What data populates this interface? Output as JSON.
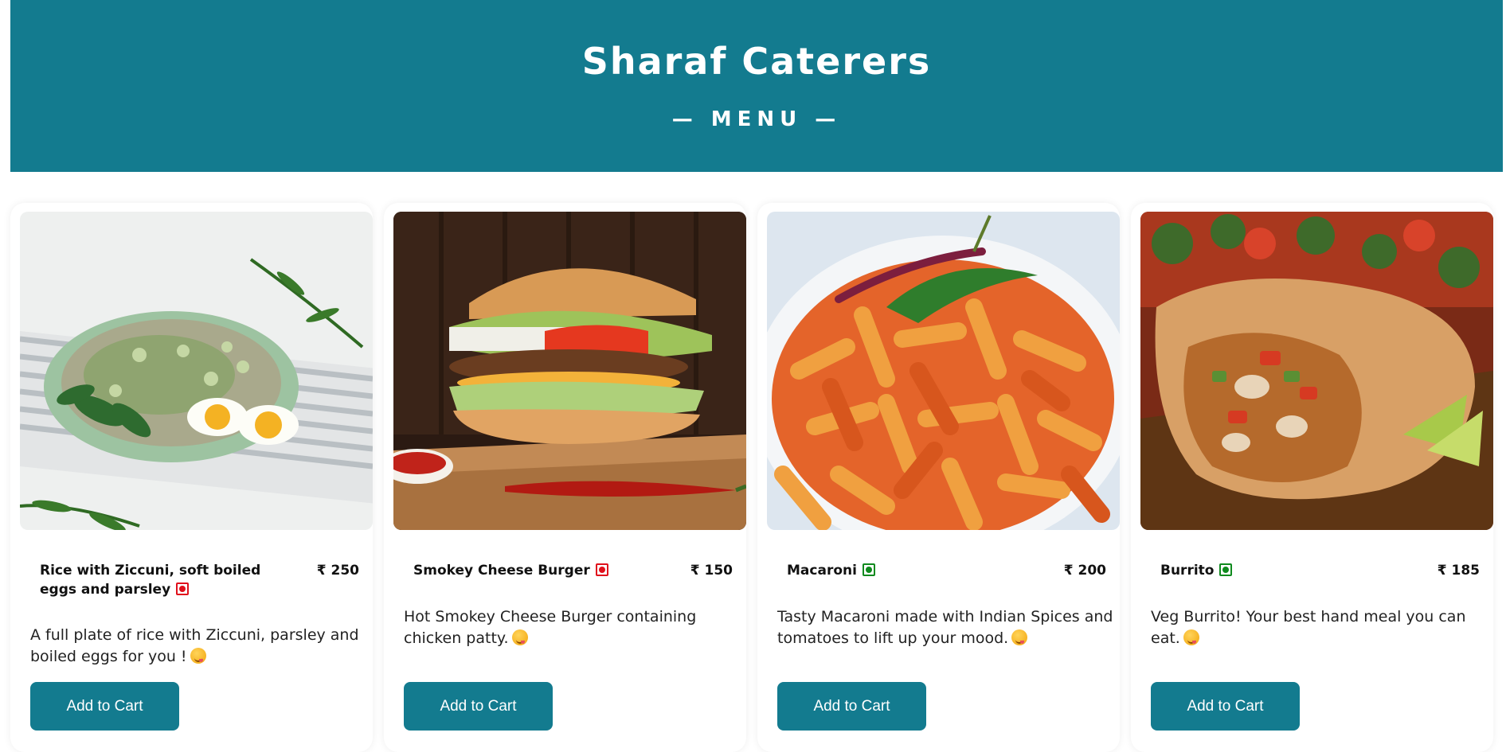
{
  "header": {
    "title": "Sharaf Caterers",
    "subtitle": "— MENU —",
    "background_color": "#137b8f"
  },
  "currency_symbol": "₹",
  "items": [
    {
      "name": "Rice with Ziccuni, soft boiled eggs and parsley",
      "diet": "non-veg",
      "price": "₹ 250",
      "description": "A full plate of rice with Ziccuni, parsley and boiled eggs for you !",
      "button_label": "Add to Cart",
      "photo_icon": "rice-bowl-photo"
    },
    {
      "name": "Smokey Cheese Burger",
      "diet": "non-veg",
      "price": "₹ 150",
      "description": "Hot Smokey Cheese Burger containing chicken patty.",
      "button_label": "Add to Cart",
      "photo_icon": "burger-photo"
    },
    {
      "name": "Macaroni",
      "diet": "veg",
      "price": "₹ 200",
      "description": "Tasty Macaroni made with Indian Spices and tomatoes to lift up your mood.",
      "button_label": "Add to Cart",
      "photo_icon": "pasta-photo"
    },
    {
      "name": "Burrito",
      "diet": "veg",
      "price": "₹ 185",
      "description": "Veg Burrito! Your best hand meal you can eat.",
      "button_label": "Add to Cart",
      "photo_icon": "burrito-photo"
    }
  ],
  "colors": {
    "accent": "#137b8f",
    "veg": "#0f8a1e",
    "non_veg": "#e0101c"
  }
}
